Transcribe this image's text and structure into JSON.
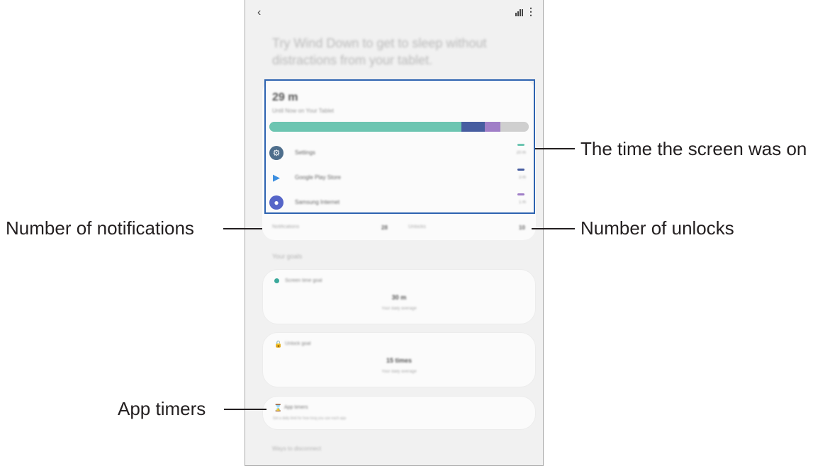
{
  "screen": {
    "headline": "Try Wind Down to get to sleep without distractions from your tablet.",
    "usage": {
      "total_time": "29 m",
      "subtitle": "Until Now on Your Tablet",
      "bar": [
        {
          "name": "Settings",
          "fraction": 0.74,
          "color": "#6cc5b1"
        },
        {
          "name": "Google Play Store",
          "fraction": 0.09,
          "color": "#475da0"
        },
        {
          "name": "Samsung Internet",
          "fraction": 0.06,
          "color": "#a07ec7"
        },
        {
          "name": "Other",
          "fraction": 0.11,
          "color": "#cfcfcf"
        }
      ],
      "apps": [
        {
          "name": "Settings",
          "time": "20 m",
          "icon": "settings-gear-icon",
          "color": "#6cc5b1"
        },
        {
          "name": "Google Play Store",
          "time": "3 m",
          "icon": "play-store-icon",
          "color": "#475da0"
        },
        {
          "name": "Samsung Internet",
          "time": "1 m",
          "icon": "samsung-internet-icon",
          "color": "#a07ec7"
        }
      ]
    },
    "counts": {
      "notifications_label": "Notifications",
      "notifications_value": "28",
      "unlocks_label": "Unlocks",
      "unlocks_value": "10"
    },
    "goals_title": "Your goals",
    "screen_time_goal": {
      "label": "Screen time goal",
      "value": "30 m",
      "sub": "Your daily average"
    },
    "unlock_goal": {
      "label": "Unlock goal",
      "value": "15 times",
      "sub": "Your daily average"
    },
    "app_timers": {
      "label": "App timers",
      "desc": "Set a daily limit for how long you use each app"
    },
    "disconnect_title": "Ways to disconnect"
  },
  "callouts": {
    "screen_time": "The time the screen was on",
    "notifications": "Number of notifications",
    "unlocks": "Number of unlocks",
    "app_timers": "App timers"
  },
  "colors": {
    "highlight_border": "#2d63b0",
    "callout_text": "#231f20",
    "timer_icon": "#e05a2b"
  }
}
